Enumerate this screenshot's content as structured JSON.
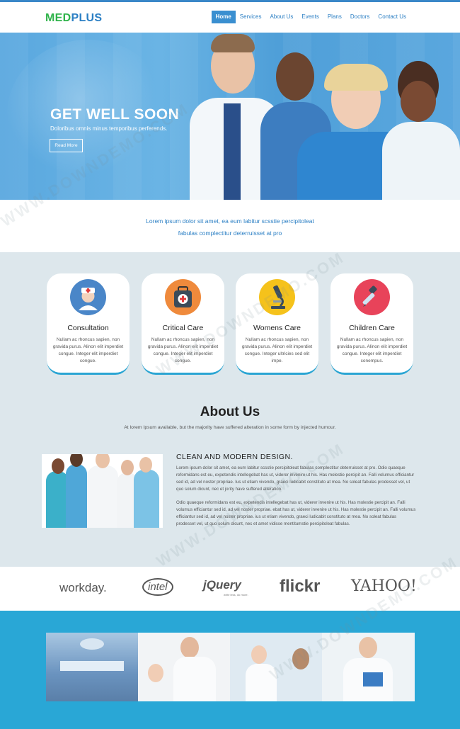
{
  "brand": {
    "part1": "MED",
    "part2": "PLUS"
  },
  "nav": [
    "Home",
    "Services",
    "About Us",
    "Events",
    "Plans",
    "Doctors",
    "Contact Us"
  ],
  "hero": {
    "title": "GET WELL SOON",
    "subtitle": "Doloribus omnis minus temporibus perferends.",
    "button": "Read More"
  },
  "intro": {
    "line1": "Lorem ipsum dolor sit amet, ea eum labitur scsstie percipitoleat",
    "line2": "fabulas complectitur deterruisset at pro"
  },
  "services": [
    {
      "title": "Consultation",
      "icon": "nurse-icon",
      "color": "#4a86c8",
      "desc": "Nullam ac rhoncus sapien, non gravida purus. Alinon elit imperdiet congue. Integer elit imperdiet congue."
    },
    {
      "title": "Critical Care",
      "icon": "medical-kit-icon",
      "color": "#ef8a3c",
      "desc": "Nullam ac rhoncus sapien, non gravida purus. Alinon elit imperdiet congue. Integer elit imperdiet congue."
    },
    {
      "title": "Womens Care",
      "icon": "microscope-icon",
      "color": "#f5c21b",
      "desc": "Nullam ac rhoncus sapien, non gravida purus. Alinon elit imperdiet congue. Integer ultricies sed elit impe."
    },
    {
      "title": "Children Care",
      "icon": "dropper-icon",
      "color": "#e8435a",
      "desc": "Nullam ac rhoncus sapien, non gravida purus. Alinon elit imperdiet congue. Integer elit imperdiet conempus."
    }
  ],
  "about": {
    "title": "About Us",
    "subtitle": "At lorem Ipsum available, but the majority have suffered alteration in some form by injected humour.",
    "heading": "CLEAN AND MODERN DESIGN.",
    "para1": "Lorem ipsum dolor sit amet, ea eum labitur scsstie percipitoleat fabulas complectitur deterruisset at pro. Odio quaeque reformidans est eu, expetendis intellegebat has ut, viderer invenire ut his. Has molestie percipit an. Falli volumus efficiantur sed id, ad vel noster propriae. Ius ut etiam vivendo, graeci ludicabit constituto at mea. No soleat fabulas prodesset vel, ut quo solum dicunt, nec et jority have suffered alteration.",
    "para2": "Odio quaeque reformidans est eu, expetendis intellegebat has ut, viderer invenire ut his. Has molestie percipit an. Falli volumus efficiantur sed id, ad vel noster propriae. ebat has ut, viderer invenire ut his. Has molestie percipit an. Falli volumus efficiantur sed id, ad vel noster propriae. ius ut etiam vivendo, graeci ludicabit constituto at mea. No soleat fabulas prodesset vel, ut quo solum dicunt, nec et amet vidisse mentitumstie percipitoleat fabulas."
  },
  "partners": [
    "workday.",
    "intel",
    "jQuery",
    "flickr",
    "YAHOO!"
  ],
  "partners_sub": {
    "jquery_tag": "write less, do more."
  },
  "watermark": "WWW.DOWNDEMO.COM",
  "colors": {
    "accent": "#3a8fd0",
    "brand_green": "#2fb34a",
    "brand_blue": "#2b7fc4",
    "gallery_bg": "#29a7d6",
    "services_bg": "#dde7ec"
  }
}
